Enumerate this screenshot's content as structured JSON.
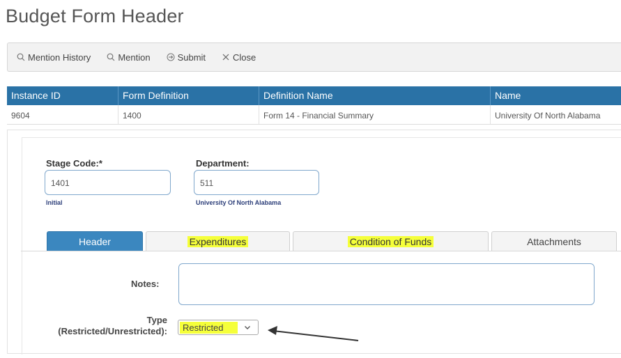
{
  "page": {
    "title": "Budget Form Header"
  },
  "toolbar": {
    "buttons": [
      {
        "label": "Mention History",
        "icon": "search-icon"
      },
      {
        "label": "Mention",
        "icon": "search-icon"
      },
      {
        "label": "Submit",
        "icon": "arrow-circle-icon"
      },
      {
        "label": "Close",
        "icon": "close-icon"
      }
    ]
  },
  "grid": {
    "headers": [
      "Instance ID",
      "Form Definition",
      "Definition Name",
      "Name"
    ],
    "rows": [
      [
        "9604",
        "1400",
        "Form 14 - Financial Summary",
        "University Of North Alabama"
      ]
    ]
  },
  "form": {
    "stage_code": {
      "label": "Stage Code:*",
      "value": "1401",
      "sub": "Initial"
    },
    "department": {
      "label": "Department:",
      "value": "511",
      "sub": "University Of North Alabama"
    }
  },
  "tabs": [
    {
      "label": "Header",
      "active": true,
      "highlighted": false
    },
    {
      "label": "Expenditures",
      "active": false,
      "highlighted": true
    },
    {
      "label": "Condition of Funds",
      "active": false,
      "highlighted": true
    },
    {
      "label": "Attachments",
      "active": false,
      "highlighted": false
    }
  ],
  "header_tab": {
    "notes_label": "Notes:",
    "notes_value": "",
    "type_label_line1": "Type",
    "type_label_line2": "(Restricted/Unrestricted):",
    "type_value": "Restricted"
  },
  "colors": {
    "grid_header": "#2a72a6",
    "tab_active": "#3b87bf",
    "highlight": "#f5ff3a",
    "field_border": "#7fa7cc",
    "sub_label": "#2d3f7a"
  }
}
